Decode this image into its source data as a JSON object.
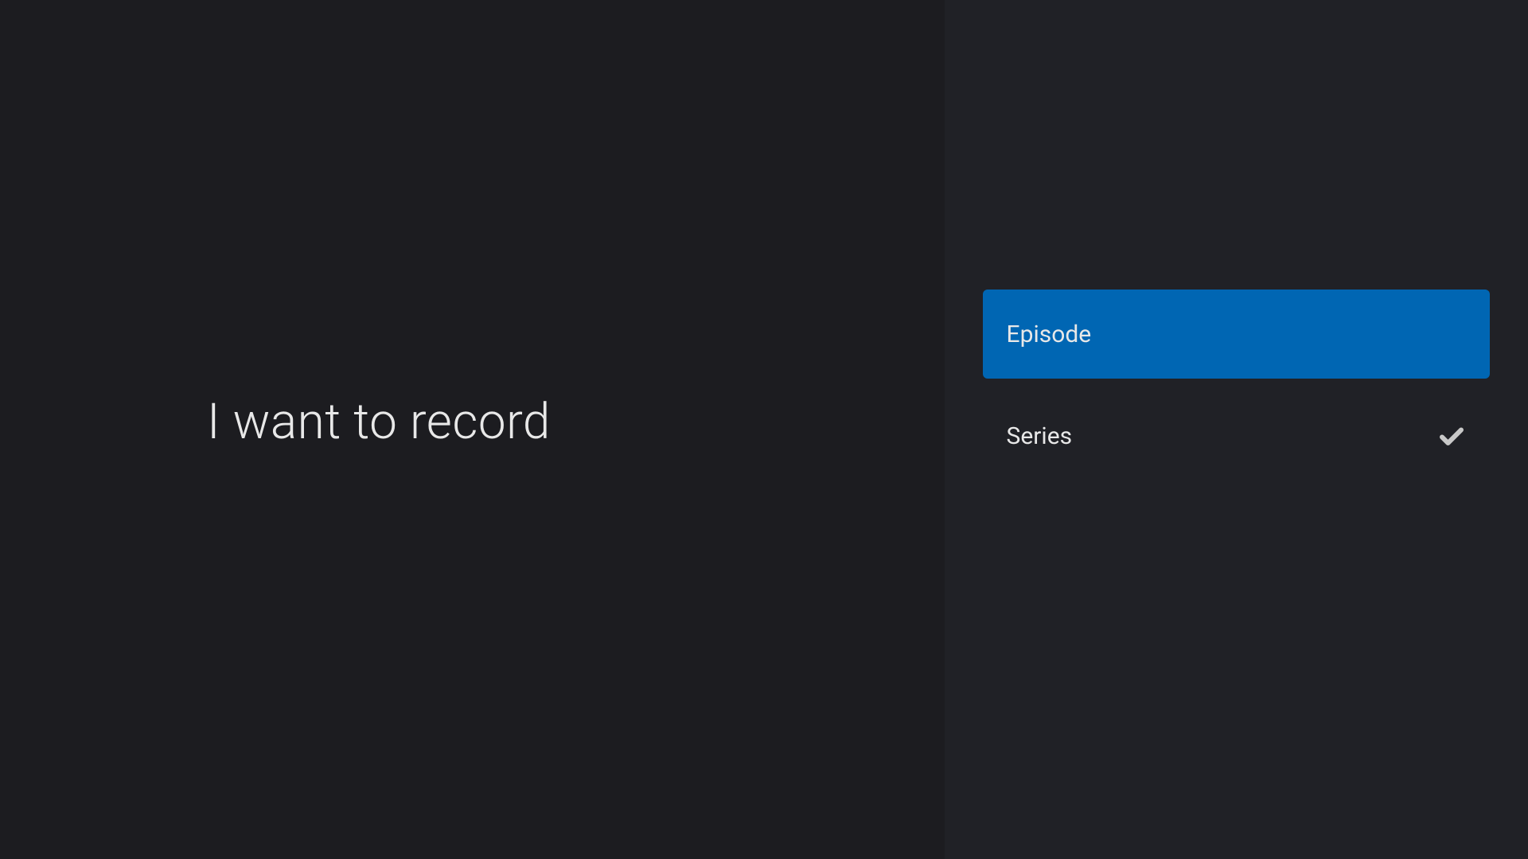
{
  "prompt": {
    "title": "I want to record"
  },
  "options": [
    {
      "label": "Episode",
      "focused": true,
      "selected": false
    },
    {
      "label": "Series",
      "focused": false,
      "selected": true
    }
  ],
  "colors": {
    "background_left": "#1c1c20",
    "background_right": "#202126",
    "accent": "#0066b3",
    "text": "#e8e8e8"
  }
}
